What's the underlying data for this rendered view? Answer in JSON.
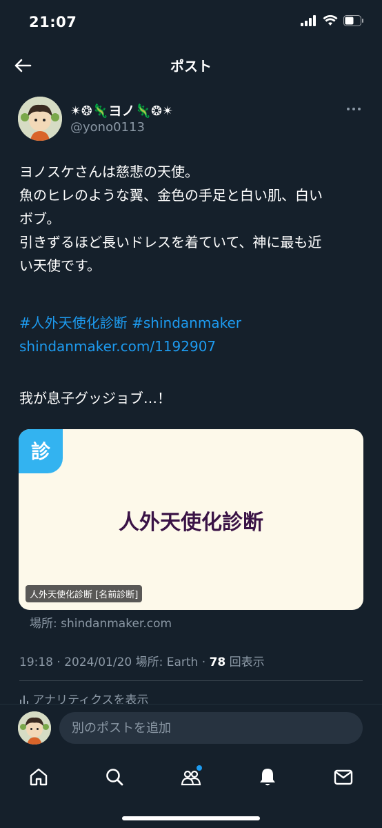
{
  "status_bar": {
    "time": "21:07"
  },
  "header": {
    "title": "ポスト"
  },
  "post": {
    "author": {
      "display_name": "✴❂🦎ヨノ🦎❂✴",
      "handle": "@yono0113"
    },
    "text": "ヨノスケさんは慈悲の天使。\n魚のヒレのような翼、金色の手足と白い肌、白い\nボブ。\n引きずるほど長いドレスを着ていて、神に最も近\nい天使です。",
    "hashtags": [
      "#人外天使化診断",
      "#shindanmaker"
    ],
    "link": "shindanmaker.com/1192907",
    "text2": "我が息子グッジョブ…！",
    "card": {
      "badge": "診",
      "title": "人外天使化診断",
      "label": "人外天使化診断 [名前診断]",
      "domain": "場所: shindanmaker.com"
    },
    "meta": {
      "time": "19:18",
      "date": "2024/01/20",
      "location": "場所: Earth",
      "views": "78",
      "views_label": "回表示"
    },
    "analytics": "アナリティクスを表示"
  },
  "reply": {
    "placeholder": "別のポストを追加"
  },
  "colors": {
    "background": "#15202b",
    "accent": "#1d9bf0",
    "muted": "#8b98a5"
  },
  "tabs": [
    "home-icon",
    "search-icon",
    "communities-icon",
    "notifications-icon",
    "messages-icon"
  ]
}
